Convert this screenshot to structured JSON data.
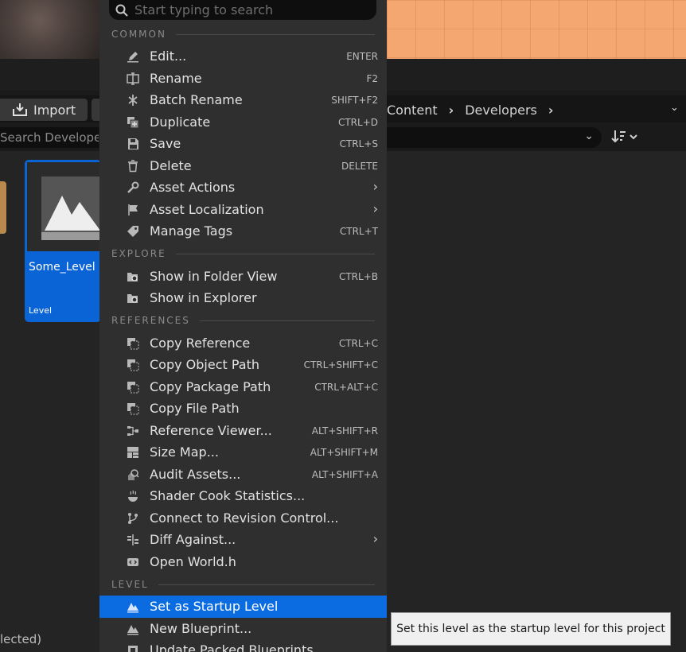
{
  "toolbar": {
    "import_label": "Import",
    "breadcrumb": [
      "Content",
      "Developers"
    ],
    "search_placeholder": "Search Develope"
  },
  "asset": {
    "name": "Some_Level",
    "type": "Level"
  },
  "status": {
    "selected_text": "lected)"
  },
  "menu": {
    "search_placeholder": "Start typing to search",
    "sections": {
      "common": "COMMON",
      "explore": "EXPLORE",
      "references": "REFERENCES",
      "level": "LEVEL"
    },
    "items": [
      {
        "label": "Edit...",
        "shortcut": "ENTER",
        "icon": "pencil-icon"
      },
      {
        "label": "Rename",
        "shortcut": "F2",
        "icon": "rename-icon"
      },
      {
        "label": "Batch Rename",
        "shortcut": "SHIFT+F2",
        "icon": "batch-rename-icon"
      },
      {
        "label": "Duplicate",
        "shortcut": "CTRL+D",
        "icon": "duplicate-icon"
      },
      {
        "label": "Save",
        "shortcut": "CTRL+S",
        "icon": "save-icon"
      },
      {
        "label": "Delete",
        "shortcut": "DELETE",
        "icon": "trash-icon"
      },
      {
        "label": "Asset Actions",
        "shortcut": "",
        "icon": "wrench-icon"
      },
      {
        "label": "Asset Localization",
        "shortcut": "",
        "icon": "flag-icon"
      },
      {
        "label": "Manage Tags",
        "shortcut": "CTRL+T",
        "icon": "tag-icon"
      },
      {
        "label": "Show in Folder View",
        "shortcut": "CTRL+B",
        "icon": "folder-search-icon"
      },
      {
        "label": "Show in Explorer",
        "shortcut": "",
        "icon": "folder-search-icon"
      },
      {
        "label": "Copy Reference",
        "shortcut": "CTRL+C",
        "icon": "copy-icon"
      },
      {
        "label": "Copy Object Path",
        "shortcut": "CTRL+SHIFT+C",
        "icon": "copy-icon"
      },
      {
        "label": "Copy Package Path",
        "shortcut": "CTRL+ALT+C",
        "icon": "copy-icon"
      },
      {
        "label": "Copy File Path",
        "shortcut": "",
        "icon": "copy-icon"
      },
      {
        "label": "Reference Viewer...",
        "shortcut": "ALT+SHIFT+R",
        "icon": "reference-viewer-icon"
      },
      {
        "label": "Size Map...",
        "shortcut": "ALT+SHIFT+M",
        "icon": "size-map-icon"
      },
      {
        "label": "Audit Assets...",
        "shortcut": "ALT+SHIFT+A",
        "icon": "audit-icon"
      },
      {
        "label": "Shader Cook Statistics...",
        "shortcut": "",
        "icon": "shader-icon"
      },
      {
        "label": "Connect to Revision Control...",
        "shortcut": "",
        "icon": "branch-icon"
      },
      {
        "label": "Diff Against...",
        "shortcut": "",
        "icon": "diff-icon"
      },
      {
        "label": "Open World.h",
        "shortcut": "",
        "icon": "code-icon"
      },
      {
        "label": "Set as Startup Level",
        "shortcut": "",
        "icon": "level-icon"
      },
      {
        "label": "New Blueprint...",
        "shortcut": "",
        "icon": "level-icon"
      },
      {
        "label": "Update Packed Blueprints",
        "shortcut": "",
        "icon": "packed-icon"
      }
    ]
  },
  "tooltip": "Set this level as the startup level for this project",
  "colors": {
    "menu_bg": "#2f2f2f",
    "selection": "#0a6ce0",
    "asset_card": "#0a64d6",
    "viewport_orange": "#f5a772"
  }
}
